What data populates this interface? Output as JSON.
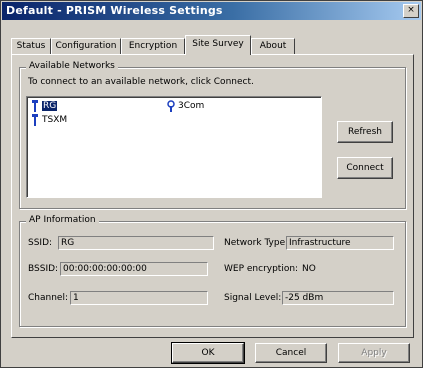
{
  "window": {
    "title": "Default - PRISM Wireless Settings",
    "close_glyph": "×"
  },
  "tabs": [
    {
      "label": "Status",
      "active": false
    },
    {
      "label": "Configuration",
      "active": false
    },
    {
      "label": "Encryption",
      "active": false
    },
    {
      "label": "Site Survey",
      "active": true
    },
    {
      "label": "About",
      "active": false
    }
  ],
  "available_networks": {
    "group_title": "Available Networks",
    "instruction": "To connect to an available network, click Connect.",
    "networks": [
      {
        "name": "RG",
        "icon": "antenna-icon",
        "selected": true
      },
      {
        "name": "3Com",
        "icon": "access-point-icon",
        "selected": false
      },
      {
        "name": "TSXM",
        "icon": "antenna-icon",
        "selected": false
      }
    ],
    "refresh_label": "Refresh",
    "connect_label": "Connect"
  },
  "ap_information": {
    "group_title": "AP Information",
    "ssid_label": "SSID:",
    "ssid_value": "RG",
    "network_type_label": "Network Type:",
    "network_type_value": "Infrastructure",
    "bssid_label": "BSSID:",
    "bssid_value": "00:00:00:00:00:00",
    "wep_label": "WEP encryption:",
    "wep_value": "NO",
    "channel_label": "Channel:",
    "channel_value": "1",
    "signal_label": "Signal Level:",
    "signal_value": "-25 dBm"
  },
  "footer": {
    "ok_label": "OK",
    "cancel_label": "Cancel",
    "apply_label": "Apply"
  },
  "colors": {
    "face": "#d4d0c8",
    "title_start": "#0a246a",
    "selection": "#0a246a",
    "icon_blue": "#1c3fbf"
  }
}
